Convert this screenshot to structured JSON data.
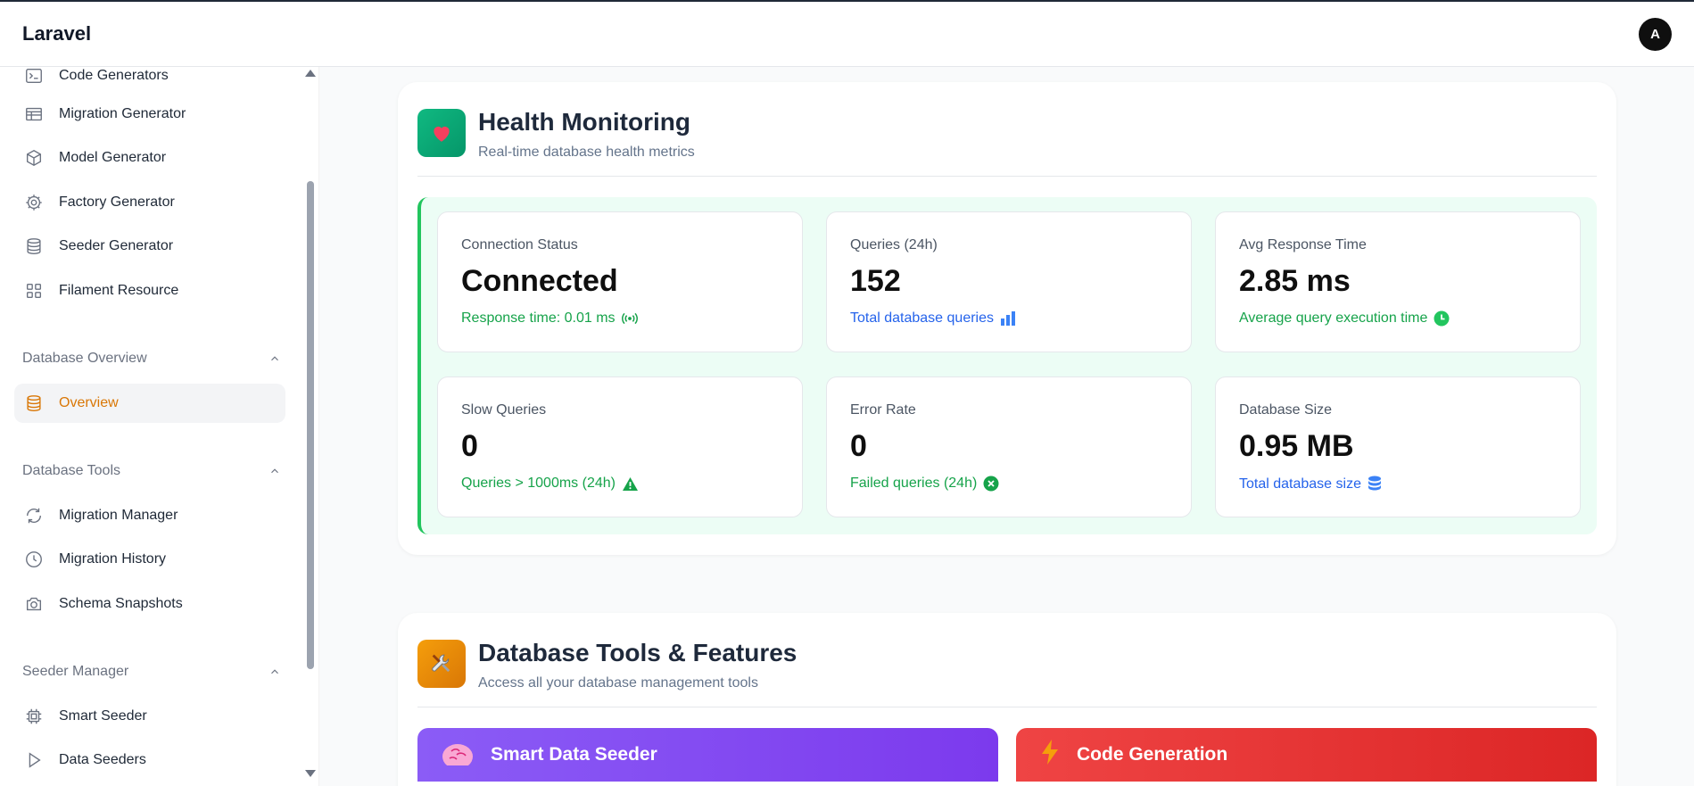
{
  "header": {
    "brand": "Laravel",
    "avatar_initial": "A"
  },
  "sidebar": {
    "items_top": [
      {
        "label": "Code Generators",
        "icon": "terminal-icon"
      },
      {
        "label": "Migration Generator",
        "icon": "table-icon"
      },
      {
        "label": "Model Generator",
        "icon": "cube-icon"
      },
      {
        "label": "Factory Generator",
        "icon": "gear-icon"
      },
      {
        "label": "Seeder Generator",
        "icon": "database-icon"
      },
      {
        "label": "Filament Resource",
        "icon": "grid-icon"
      }
    ],
    "groups": {
      "database_overview": {
        "label": "Database Overview",
        "items": [
          {
            "label": "Overview",
            "icon": "database-icon",
            "active": true
          }
        ]
      },
      "database_tools": {
        "label": "Database Tools",
        "items": [
          {
            "label": "Migration Manager",
            "icon": "refresh-icon"
          },
          {
            "label": "Migration History",
            "icon": "clock-icon"
          },
          {
            "label": "Schema Snapshots",
            "icon": "camera-icon"
          }
        ]
      },
      "seeder_manager": {
        "label": "Seeder Manager",
        "items": [
          {
            "label": "Smart Seeder",
            "icon": "chip-icon"
          },
          {
            "label": "Data Seeders",
            "icon": "play-icon"
          }
        ]
      }
    }
  },
  "health": {
    "icon": "heart-icon",
    "title": "Health Monitoring",
    "subtitle": "Real-time database health metrics",
    "accent": "#22c55e",
    "metrics": [
      {
        "label": "Connection Status",
        "value": "Connected",
        "note": "Response time: 0.01 ms",
        "note_icon": "signal-icon",
        "note_color": "green"
      },
      {
        "label": "Queries (24h)",
        "value": "152",
        "note": "Total database queries",
        "note_icon": "bar-chart-icon",
        "note_color": "blue"
      },
      {
        "label": "Avg Response Time",
        "value": "2.85 ms",
        "note": "Average query execution time",
        "note_icon": "clock-icon",
        "note_color": "green"
      },
      {
        "label": "Slow Queries",
        "value": "0",
        "note": "Queries > 1000ms (24h)",
        "note_icon": "warning-icon",
        "note_color": "green"
      },
      {
        "label": "Error Rate",
        "value": "0",
        "note": "Failed queries (24h)",
        "note_icon": "x-circle-icon",
        "note_color": "green"
      },
      {
        "label": "Database Size",
        "value": "0.95 MB",
        "note": "Total database size",
        "note_icon": "database-icon",
        "note_color": "blue"
      }
    ]
  },
  "tools": {
    "icon": "tools-icon",
    "title": "Database Tools & Features",
    "subtitle": "Access all your database management tools",
    "features": [
      {
        "label": "Smart Data Seeder",
        "icon": "brain-icon",
        "color_from": "#8b5cf6",
        "color_to": "#7c3aed"
      },
      {
        "label": "Code Generation",
        "icon": "lightning-icon",
        "color_from": "#ef4444",
        "color_to": "#dc2626"
      }
    ]
  }
}
